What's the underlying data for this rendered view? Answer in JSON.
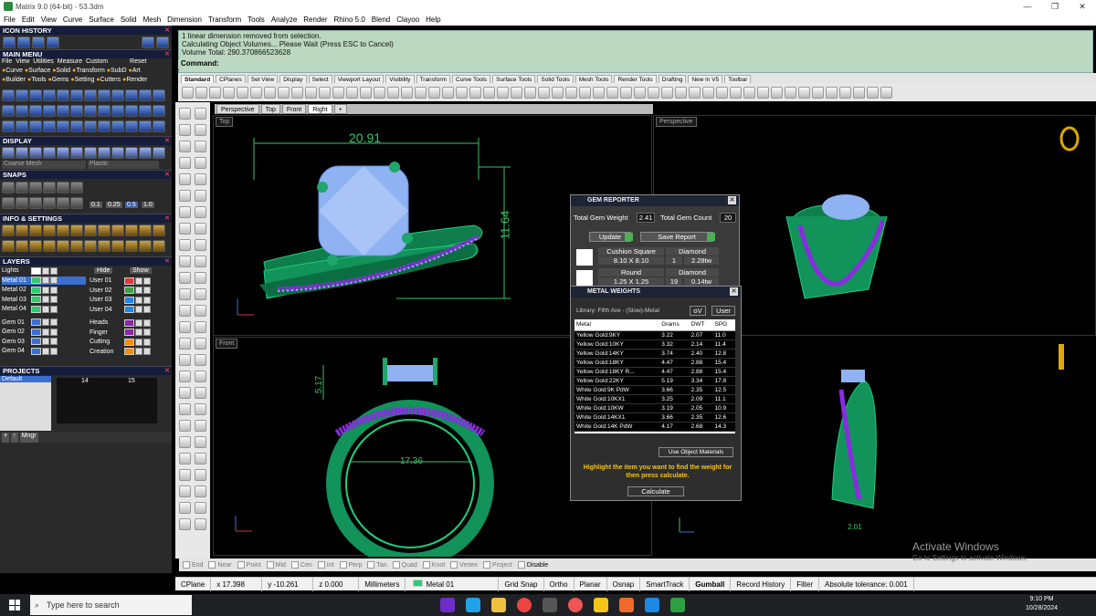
{
  "window": {
    "title": "Matrix 9.0 (64-bit) - 53.3dm",
    "controls": [
      "—",
      "❐",
      "✕"
    ]
  },
  "menu": [
    "File",
    "Edit",
    "View",
    "Curve",
    "Surface",
    "Solid",
    "Mesh",
    "Dimension",
    "Transform",
    "Tools",
    "Analyze",
    "Render",
    "Rhino 5.0",
    "Blend",
    "Clayoo",
    "Help"
  ],
  "left_panel": {
    "icon_history": "ICON HISTORY",
    "main_menu": "MAIN MENU",
    "main_menu_row1": [
      "File",
      "View",
      "Utilities",
      "Measure",
      "Custom",
      "Reset"
    ],
    "main_menu_row2": [
      "Curve",
      "Surface",
      "Solid",
      "Transform",
      "SubD",
      "Art"
    ],
    "main_menu_row3": [
      "Builder",
      "Tools",
      "Gems",
      "Setting",
      "Cutters",
      "Render"
    ],
    "display": "DISPLAY",
    "display_modes": [
      "Coarse Mesh",
      "Plastic"
    ],
    "snaps": "SNAPS",
    "snap_values": [
      "0.1",
      "0.25",
      "0.5",
      "1.0"
    ],
    "info_settings": "INFO & SETTINGS",
    "layers": "LAYERS",
    "layers_left": [
      "Lights",
      "Metal 01",
      "Metal 02",
      "Metal 03",
      "Metal 04",
      "Gem 01",
      "Gem 02",
      "Gem 03",
      "Gem 04"
    ],
    "layers_left_colors": [
      "#ffffff",
      "#2ecc71",
      "#2ecc71",
      "#2ecc71",
      "#2ecc71",
      "#3b6fd6",
      "#3b6fd6",
      "#3b6fd6",
      "#3b6fd6"
    ],
    "layers_right_header": [
      "Hide",
      "Show"
    ],
    "layers_right": [
      "User 01",
      "User 02",
      "User 03",
      "User 04",
      "Heads",
      "Finger",
      "Cutting",
      "Creation"
    ],
    "layers_right_colors": [
      "#e53935",
      "#43a047",
      "#1e88e5",
      "#1e88e5",
      "#8e24aa",
      "#8e24aa",
      "#fb8c00",
      "#fb8c00"
    ],
    "projects": "PROJECTS",
    "projects_default": "Default",
    "project_numbers": [
      "14",
      "15"
    ],
    "mngr": "Mngr"
  },
  "command": {
    "lines": [
      "1 linear dimension removed from selection.",
      "Calculating Object Volumes... Please Wait (Press ESC to Cancel)",
      "Volume Total: 290.370866523628"
    ],
    "prompt": "Command:"
  },
  "toolbar_tabs": [
    "Standard",
    "CPlanes",
    "Set View",
    "Display",
    "Select",
    "Viewport Layout",
    "Visibility",
    "Transform",
    "Curve Tools",
    "Surface Tools",
    "Solid Tools",
    "Mesh Tools",
    "Render Tools",
    "Drafting",
    "New in V5",
    "Toolbar"
  ],
  "viewport_tabs": [
    "Perspective",
    "Top",
    "Front",
    "Right"
  ],
  "viewports": {
    "top": {
      "label": "Top",
      "dim_width": "20.91",
      "dim_height": "11.64"
    },
    "front": {
      "label": "Front",
      "dim_height": "5.17",
      "dim_diameter": "17.36"
    },
    "perspective": {
      "label": "Perspective",
      "dim_small": "2.01"
    }
  },
  "gem_reporter": {
    "title": "GEM REPORTER",
    "total_weight_label": "Total Gem Weight",
    "total_weight": "2.41",
    "total_count_label": "Total Gem Count",
    "total_count": "20",
    "update": "Update",
    "save_report": "Save Report",
    "gems": [
      {
        "cut": "Cushion Square",
        "material": "Diamond",
        "size": "8.10 X 8.10",
        "count": "1",
        "weight": "2.28tw"
      },
      {
        "cut": "Round",
        "material": "Diamond",
        "size": "1.25 X 1.25",
        "count": "19",
        "weight": "0.14tw"
      }
    ]
  },
  "metal_weights": {
    "title": "METAL WEIGHTS",
    "library": "Library: Fifth Ave - (Slow)-Metal",
    "toggles": [
      "oV",
      "User"
    ],
    "columns": [
      "Metal",
      "Grams",
      "DWT",
      "SPG"
    ],
    "rows": [
      [
        "Yellow Gold:9KY",
        "3.22",
        "2.07",
        "11.0"
      ],
      [
        "Yellow Gold:10KY",
        "3.32",
        "2.14",
        "11.4"
      ],
      [
        "Yellow Gold:14KY",
        "3.74",
        "2.40",
        "12.8"
      ],
      [
        "Yellow Gold:18KY",
        "4.47",
        "2.88",
        "15.4"
      ],
      [
        "Yellow Gold:18KY R...",
        "4.47",
        "2.88",
        "15.4"
      ],
      [
        "Yellow Gold:22KY",
        "5.19",
        "3.34",
        "17.8"
      ],
      [
        "White Gold:9K PdW",
        "3.66",
        "2.35",
        "12.5"
      ],
      [
        "White Gold:10KX1",
        "3.25",
        "2.09",
        "11.1"
      ],
      [
        "White Gold:10KW",
        "3.19",
        "2.05",
        "10.9"
      ],
      [
        "White Gold:14KX1",
        "3.66",
        "2.35",
        "12.6"
      ],
      [
        "White Gold:14K PdW",
        "4.17",
        "2.68",
        "14.3"
      ]
    ],
    "use_object_materials": "Use Object Materials",
    "hint": "Highlight the item you want to find the weight for then press calculate.",
    "calculate": "Calculate"
  },
  "osnaps": [
    "End",
    "Near",
    "Point",
    "Mid",
    "Cen",
    "Int",
    "Perp",
    "Tan",
    "Quad",
    "Knot",
    "Vertex",
    "Project",
    "Disable"
  ],
  "status": {
    "cplane": "CPlane",
    "x": "x 17.398",
    "y": "y -10.261",
    "z": "z 0.000",
    "units": "Millimeters",
    "layer": "Metal 01",
    "buttons": [
      "Grid Snap",
      "Ortho",
      "Planar",
      "Osnap",
      "SmartTrack",
      "Gumball",
      "Record History",
      "Filter"
    ],
    "tolerance": "Absolute tolerance: 0.001"
  },
  "watermark": {
    "line1": "Activate Windows",
    "line2": "Go to Settings to activate Windows."
  },
  "taskbar": {
    "search_placeholder": "Type here to search",
    "time": "9:10 PM",
    "date": "10/28/2024"
  },
  "colors": {
    "metal": "#1fa66a",
    "gem": "#8fb2f2",
    "melee": "#8a2be2",
    "dimension": "#3bc26a",
    "command_bg": "#bcd8c0"
  }
}
